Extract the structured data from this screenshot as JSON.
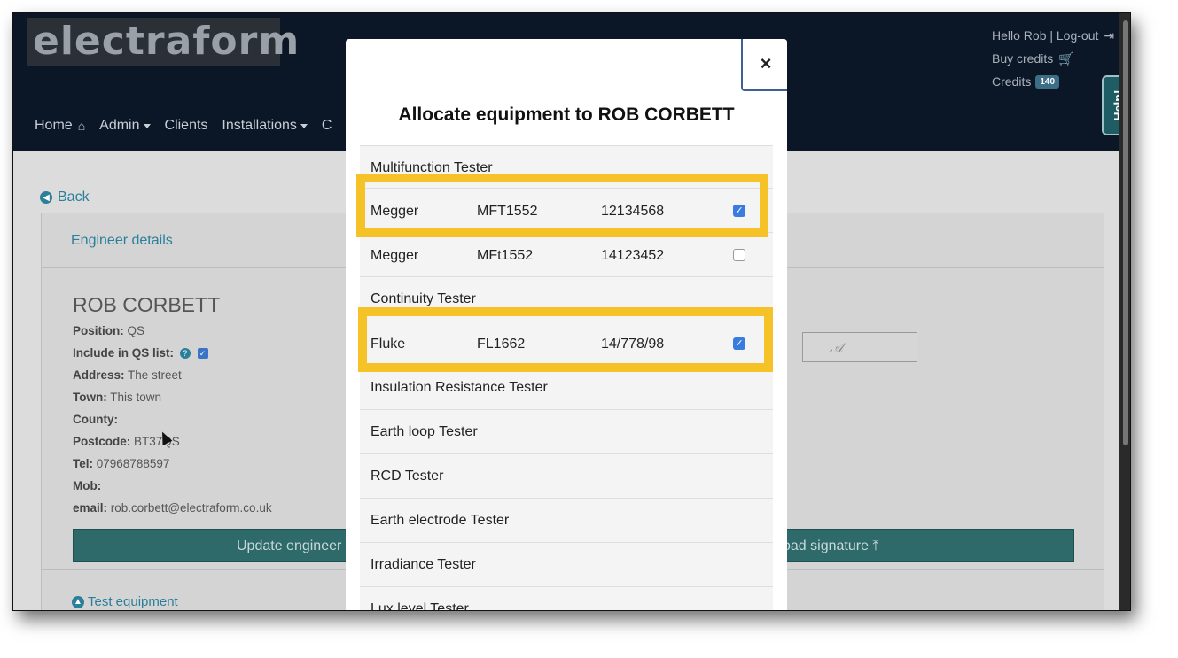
{
  "header": {
    "logo": "electraform",
    "greeting": "Hello Rob | Log-out",
    "buy_credits": "Buy credits",
    "credits_label": "Credits",
    "credits_count": "140",
    "help": "Help!"
  },
  "nav": {
    "items": [
      "Home",
      "Admin",
      "Clients",
      "Installations",
      "C"
    ]
  },
  "page": {
    "back": "Back",
    "engineer_details": "Engineer details",
    "engineer_name": "ROB CORBETT",
    "position_label": "Position:",
    "position": "QS",
    "qs_label": "Include in QS list:",
    "address_label": "Address:",
    "address": "The street",
    "town_label": "Town:",
    "town": "This town",
    "county_label": "County:",
    "county": "",
    "postcode_label": "Postcode:",
    "postcode": "BT37QS",
    "tel_label": "Tel:",
    "tel": "07968788597",
    "mob_label": "Mob:",
    "mob": "",
    "email_label": "email:",
    "email": "rob.corbett@electraform.co.uk",
    "update_button": "Update engineer",
    "upload_signature": "oad signature",
    "test_equipment": "Test equipment"
  },
  "modal": {
    "close": "×",
    "title": "Allocate equipment to ROB CORBETT",
    "categories": {
      "multifunction": "Multifunction Tester",
      "continuity": "Continuity Tester",
      "insulation": "Insulation Resistance Tester",
      "earth_loop": "Earth loop Tester",
      "rcd": "RCD Tester",
      "earth_electrode": "Earth electrode Tester",
      "irradiance": "Irradiance Tester",
      "lux": "Lux level Tester"
    },
    "equipment": [
      {
        "make": "Megger",
        "model": "MFT1552",
        "serial": "12134568",
        "checked": true
      },
      {
        "make": "Megger",
        "model": "MFt1552",
        "serial": "14123452",
        "checked": false
      },
      {
        "make": "Fluke",
        "model": "FL1662",
        "serial": "14/778/98",
        "checked": true
      }
    ]
  },
  "colors": {
    "navbar": "#0b1627",
    "highlight": "#f5c328",
    "accent": "#2a7f9a",
    "button": "#2f6a6a"
  }
}
